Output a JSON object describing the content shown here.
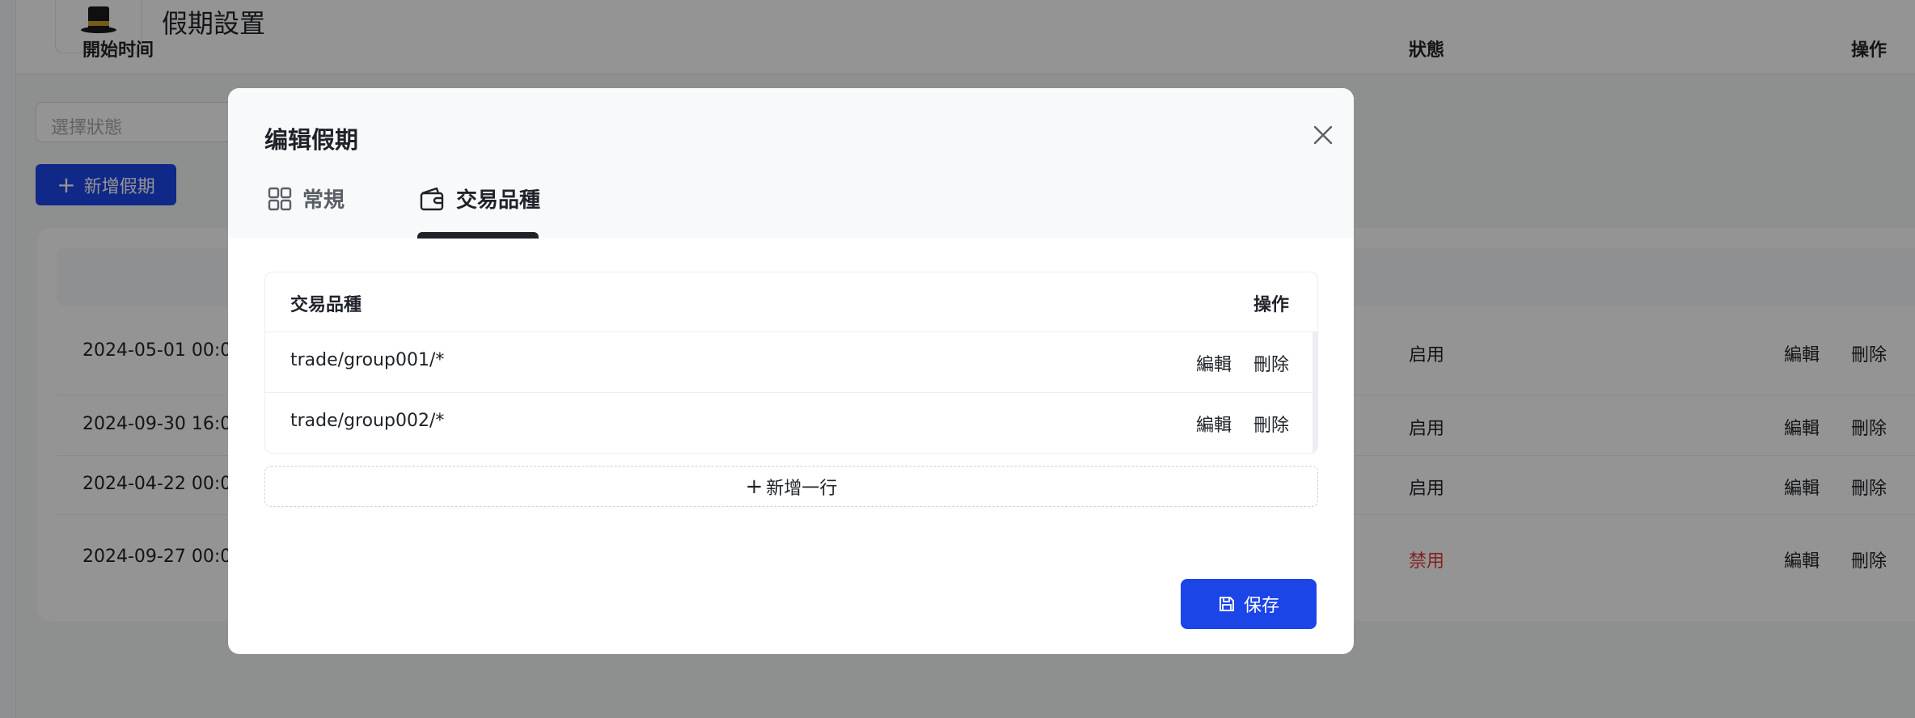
{
  "page": {
    "title": "假期設置",
    "status_filter_placeholder": "選擇狀態",
    "add_button": "新增假期",
    "table": {
      "columns": {
        "start_time": "開始时间",
        "status": "狀態",
        "actions": "操作"
      },
      "rows": [
        {
          "start": "2024-05-01 00:0",
          "status": "启用",
          "edit": "編輯",
          "delete": "刪除"
        },
        {
          "start": "2024-09-30 16:0",
          "status": "启用",
          "edit": "編輯",
          "delete": "刪除"
        },
        {
          "start": "2024-04-22 00:0",
          "status": "启用",
          "edit": "編輯",
          "delete": "刪除"
        },
        {
          "start": "2024-09-27 00:0",
          "status": "禁用",
          "edit": "編輯",
          "delete": "刪除"
        }
      ]
    }
  },
  "modal": {
    "title": "编辑假期",
    "tabs": [
      {
        "label": "常規",
        "icon": "grid-icon",
        "active": false
      },
      {
        "label": "交易品種",
        "icon": "wallet-icon",
        "active": true
      }
    ],
    "table": {
      "columns": {
        "symbol": "交易品種",
        "actions": "操作"
      },
      "rows": [
        {
          "symbol": "trade/group001/*",
          "edit": "編輯",
          "delete": "刪除"
        },
        {
          "symbol": "trade/group002/*",
          "edit": "編輯",
          "delete": "刪除"
        }
      ]
    },
    "add_row_label": "新增一行",
    "save_label": "保存"
  },
  "colors": {
    "primary": "#1c45e8",
    "disabled_status": "#e23b3b",
    "overlay": "rgba(0,0,0,0.42)"
  }
}
